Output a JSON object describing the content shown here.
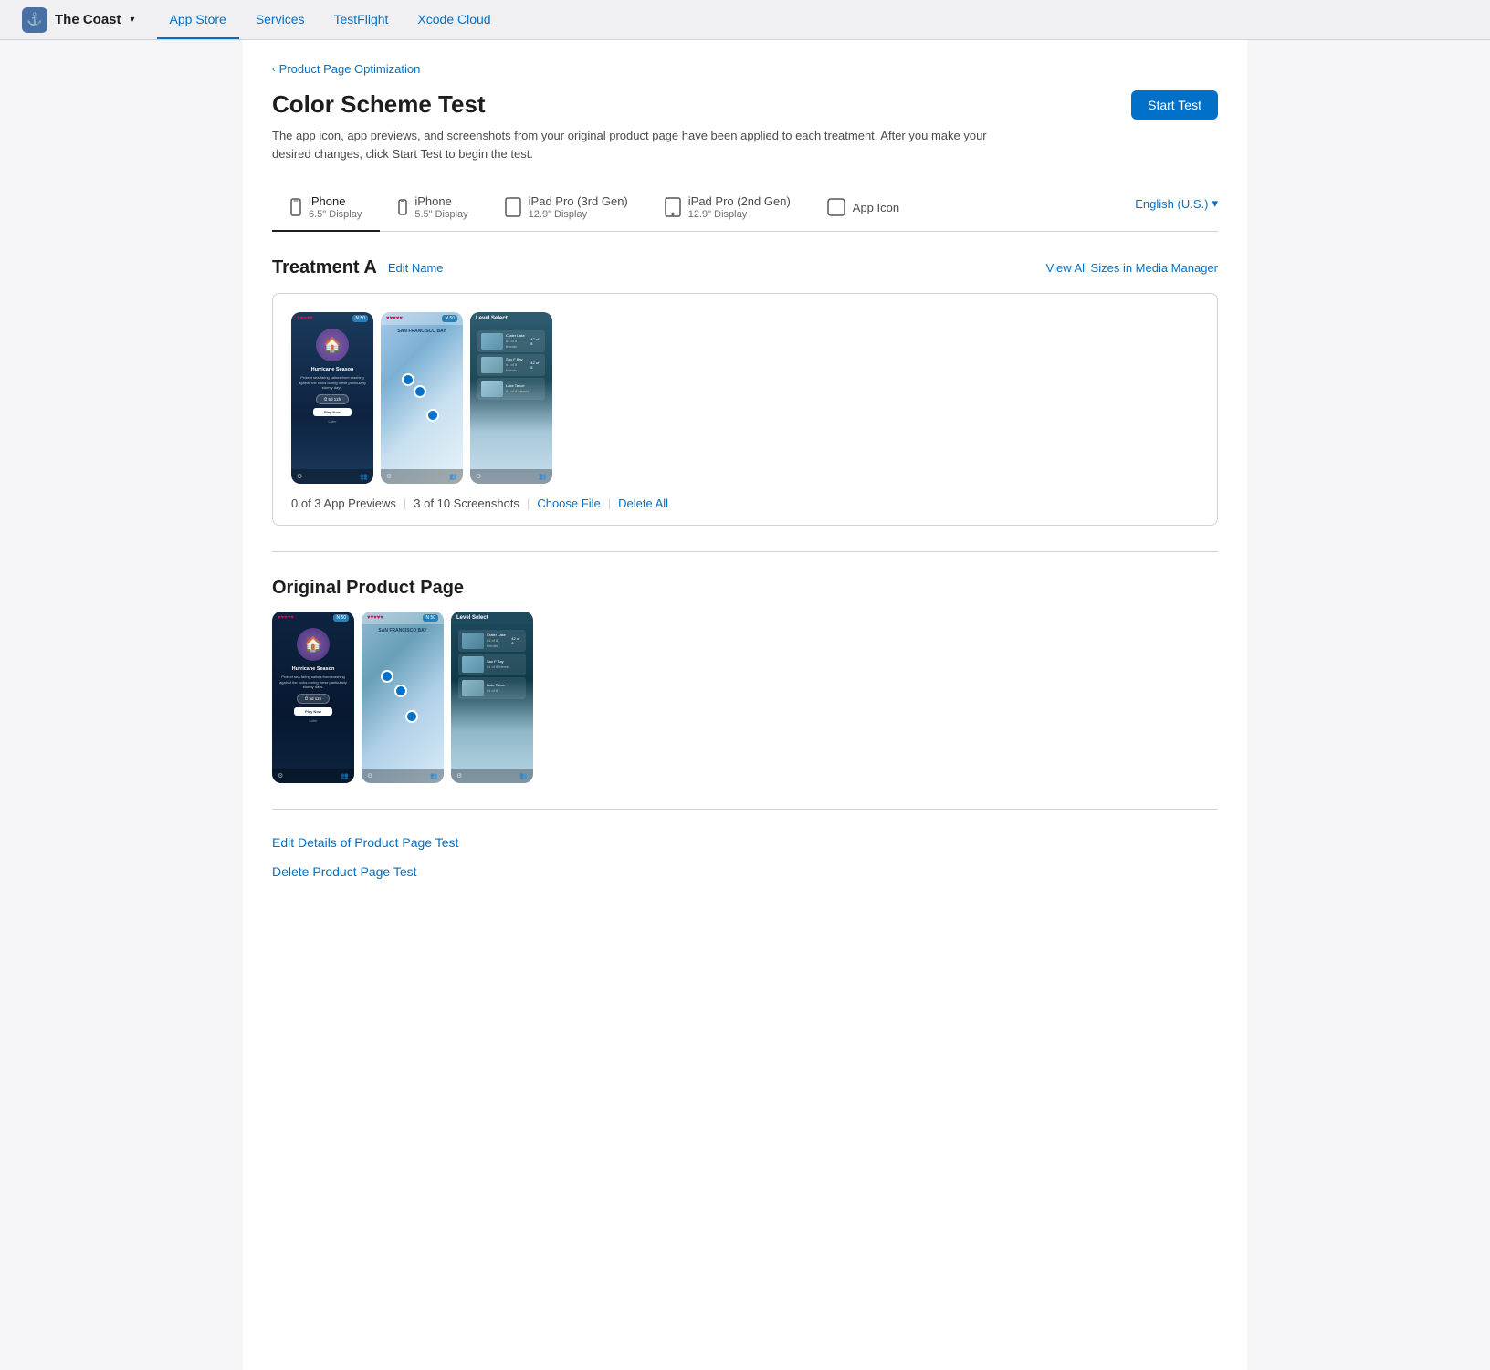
{
  "nav": {
    "brand_name": "The Coast",
    "brand_chevron": "▾",
    "links": [
      {
        "id": "app-store",
        "label": "App Store",
        "active": true
      },
      {
        "id": "services",
        "label": "Services",
        "active": false
      },
      {
        "id": "testflight",
        "label": "TestFlight",
        "active": false
      },
      {
        "id": "xcode-cloud",
        "label": "Xcode Cloud",
        "active": false
      }
    ]
  },
  "breadcrumb": {
    "chevron": "‹",
    "label": "Product Page Optimization"
  },
  "page": {
    "title": "Color Scheme Test",
    "description": "The app icon, app previews, and screenshots from your original product page have been applied to each treatment. After you make your desired changes, click Start Test to begin the test.",
    "start_test_label": "Start Test"
  },
  "device_tabs": [
    {
      "id": "iphone65",
      "name": "iPhone",
      "size": "6.5\" Display",
      "active": true
    },
    {
      "id": "iphone55",
      "name": "iPhone",
      "size": "5.5\" Display",
      "active": false
    },
    {
      "id": "ipadpro3",
      "name": "iPad Pro (3rd Gen)",
      "size": "12.9\" Display",
      "active": false
    },
    {
      "id": "ipadpro2",
      "name": "iPad Pro (2nd Gen)",
      "size": "12.9\" Display",
      "active": false
    },
    {
      "id": "appicon",
      "name": "App Icon",
      "size": "",
      "active": false
    }
  ],
  "language_selector": {
    "label": "English (U.S.)",
    "chevron": "▾"
  },
  "treatment_a": {
    "title": "Treatment A",
    "edit_name_label": "Edit Name",
    "view_all_label": "View All Sizes in Media Manager",
    "previews_count": "0 of 3 App Previews",
    "screenshots_count": "3  of 10 Screenshots",
    "choose_file_label": "Choose File",
    "delete_all_label": "Delete All"
  },
  "original_page": {
    "title": "Original Product Page"
  },
  "bottom_actions": {
    "edit_label": "Edit Details of Product Page Test",
    "delete_label": "Delete Product Page Test"
  },
  "screens": {
    "hurricane_title": "Hurricane Season",
    "hurricane_subtitle": "Protect sea-faring sailors from crashing against the rocks during these particularly stormy days.",
    "timer": "⏱ 5d 12h",
    "play_btn": "Play Now",
    "later": "Later",
    "sf_bay": "SAN FRANCISCO BAY",
    "level_select": "Level Select",
    "crater_lake": "Crater Lake",
    "san_f_bay": "San F Bay"
  }
}
